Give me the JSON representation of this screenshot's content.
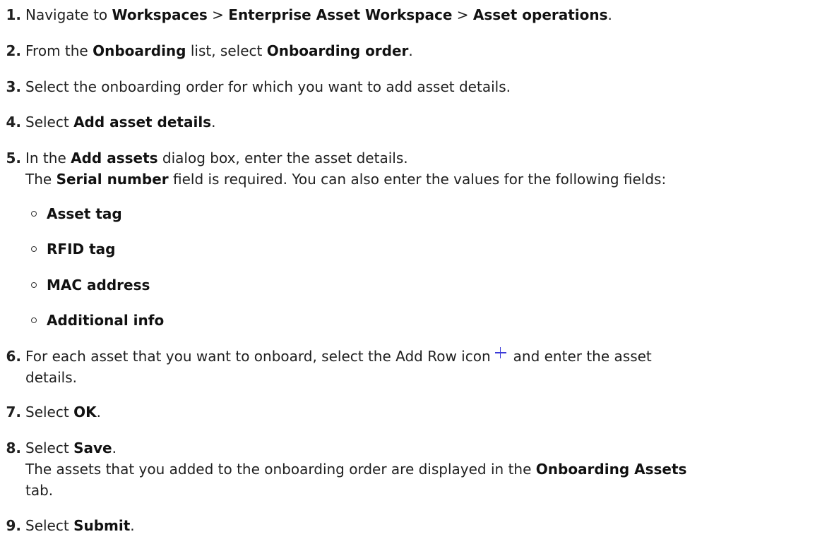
{
  "steps": [
    {
      "num": "1.",
      "parts": [
        "Navigate to ",
        "Workspaces",
        " > ",
        "Enterprise Asset Workspace",
        " > ",
        "Asset operations",
        "."
      ]
    },
    {
      "num": "2.",
      "parts": [
        "From the ",
        "Onboarding",
        " list, select ",
        "Onboarding order",
        "."
      ]
    },
    {
      "num": "3.",
      "text": "Select the onboarding order for which you want to add asset details."
    },
    {
      "num": "4.",
      "parts": [
        "Select ",
        "Add asset details",
        "."
      ]
    },
    {
      "num": "5.",
      "parts": [
        "In the ",
        "Add assets",
        " dialog box, enter the asset details."
      ],
      "cont_parts": [
        "The ",
        "Serial number",
        " field is required. You can also enter the values for the following fields:"
      ],
      "fields": [
        "Asset tag",
        "RFID tag",
        "MAC address",
        "Additional info"
      ]
    },
    {
      "num": "6.",
      "text_before_icon": "For each asset that you want to onboard, select the Add Row icon",
      "text_after_icon": "and enter the asset",
      "cont": "details.",
      "icon": "plus-icon"
    },
    {
      "num": "7.",
      "parts": [
        "Select ",
        "OK",
        "."
      ]
    },
    {
      "num": "8.",
      "parts": [
        "Select ",
        "Save",
        "."
      ],
      "cont_parts": [
        "The assets that you added to the onboarding order are displayed in the ",
        "Onboarding Assets"
      ],
      "cont2": "tab."
    },
    {
      "num": "9.",
      "parts": [
        "Select ",
        "Submit",
        "."
      ]
    }
  ],
  "colors": {
    "text": "#1f1f1f",
    "icon_accent": "#3b3bd8"
  }
}
